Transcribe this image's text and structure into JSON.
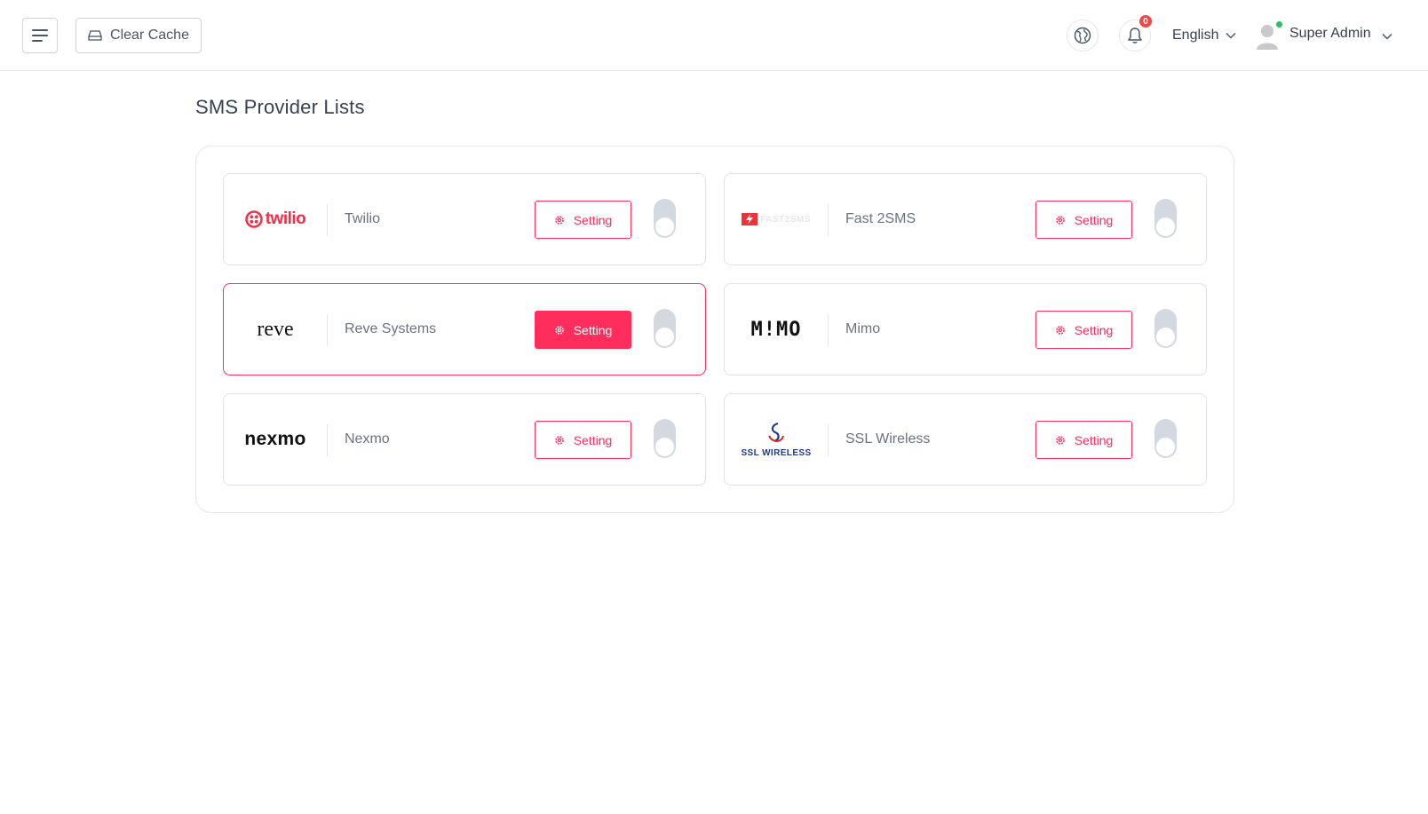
{
  "header": {
    "clear_cache_label": "Clear Cache",
    "notification_count": "0",
    "language": "English",
    "user_name": "Super Admin"
  },
  "page": {
    "title": "SMS Provider Lists"
  },
  "providers": [
    {
      "name": "Twilio",
      "logo_text": "twilio",
      "setting_label": "Setting",
      "enabled": false,
      "active": false
    },
    {
      "name": "Fast 2SMS",
      "logo_text": "FAST2SMS",
      "setting_label": "Setting",
      "enabled": false,
      "active": false
    },
    {
      "name": "Reve Systems",
      "logo_text": "reve",
      "setting_label": "Setting",
      "enabled": false,
      "active": true
    },
    {
      "name": "Mimo",
      "logo_text": "M!MO",
      "setting_label": "Setting",
      "enabled": false,
      "active": false
    },
    {
      "name": "Nexmo",
      "logo_text": "nexmo",
      "setting_label": "Setting",
      "enabled": false,
      "active": false
    },
    {
      "name": "SSL Wireless",
      "logo_text": "SSL WIRELESS",
      "setting_label": "Setting",
      "enabled": false,
      "active": false
    }
  ],
  "colors": {
    "accent": "#ff2d5b",
    "border": "#dfe2e6",
    "toggle_off": "#d4d8e0",
    "online": "#22c55e",
    "badge": "#f04747"
  },
  "icons": {
    "menu": "hamburger-icon",
    "clear_cache": "drive-icon",
    "globe": "globe-icon",
    "bell": "bell-icon",
    "chevron": "chevron-down-icon",
    "avatar": "user-avatar-icon",
    "setting": "gear-icon"
  }
}
